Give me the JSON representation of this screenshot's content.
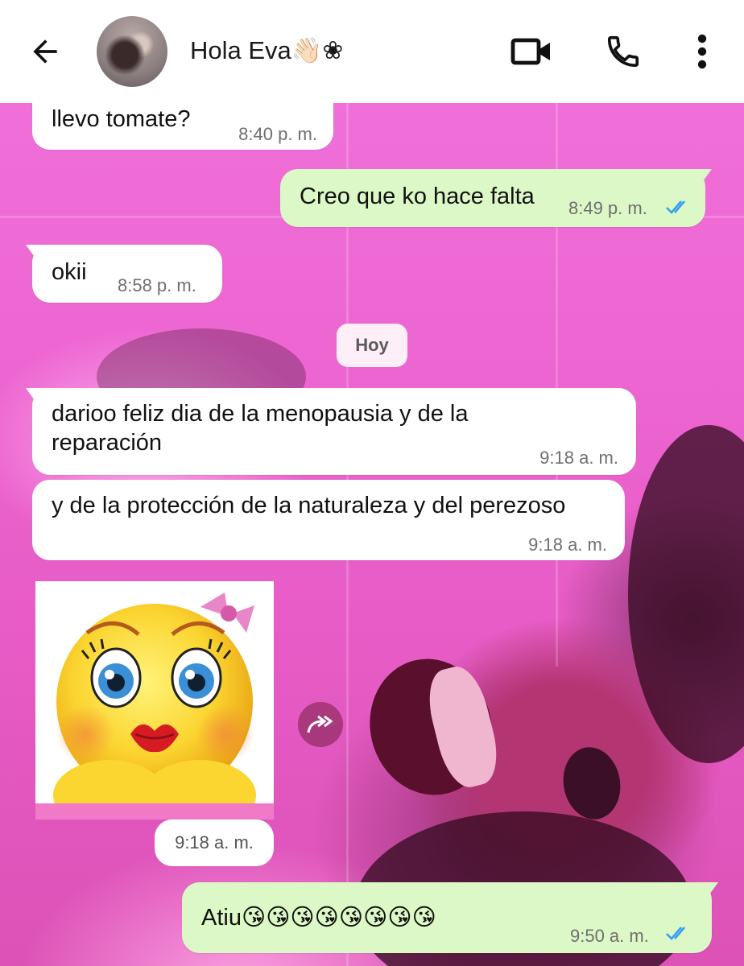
{
  "header": {
    "contact_name": "Hola Eva👋🏻❀",
    "icons": {
      "back": "arrow-left-icon",
      "video": "video-camera-icon",
      "call": "phone-icon",
      "menu": "more-vertical-icon"
    }
  },
  "messages": [
    {
      "direction": "in",
      "text": "llevo tomate?",
      "time": "8:40 p. m."
    },
    {
      "direction": "out",
      "text": "Creo que ko hace falta",
      "time": "8:49 p. m.",
      "status": "read"
    },
    {
      "direction": "in",
      "text": "okii",
      "time": "8:58 p. m."
    },
    {
      "direction": "in",
      "text_lines": [
        "darioo feliz dia de la menopausia y de la",
        "reparación"
      ],
      "time": "9:18 a. m."
    },
    {
      "direction": "in",
      "text": "y de la protección de la naturaleza y del perezoso",
      "time": "9:18 a. m."
    },
    {
      "direction": "in",
      "type": "sticker",
      "sticker": "kissing-emoji-sticker",
      "time": "9:18 a. m."
    },
    {
      "direction": "out",
      "text": "Atiu😘😘😘😘😘😘😘😘",
      "time": "9:50 a. m.",
      "status": "read"
    }
  ],
  "date_separator": "Hoy",
  "colors": {
    "incoming_bubble": "#ffffff",
    "outgoing_bubble": "#dcf8c6",
    "read_ticks": "#34a0f2",
    "wallpaper": "#e85ccd"
  }
}
